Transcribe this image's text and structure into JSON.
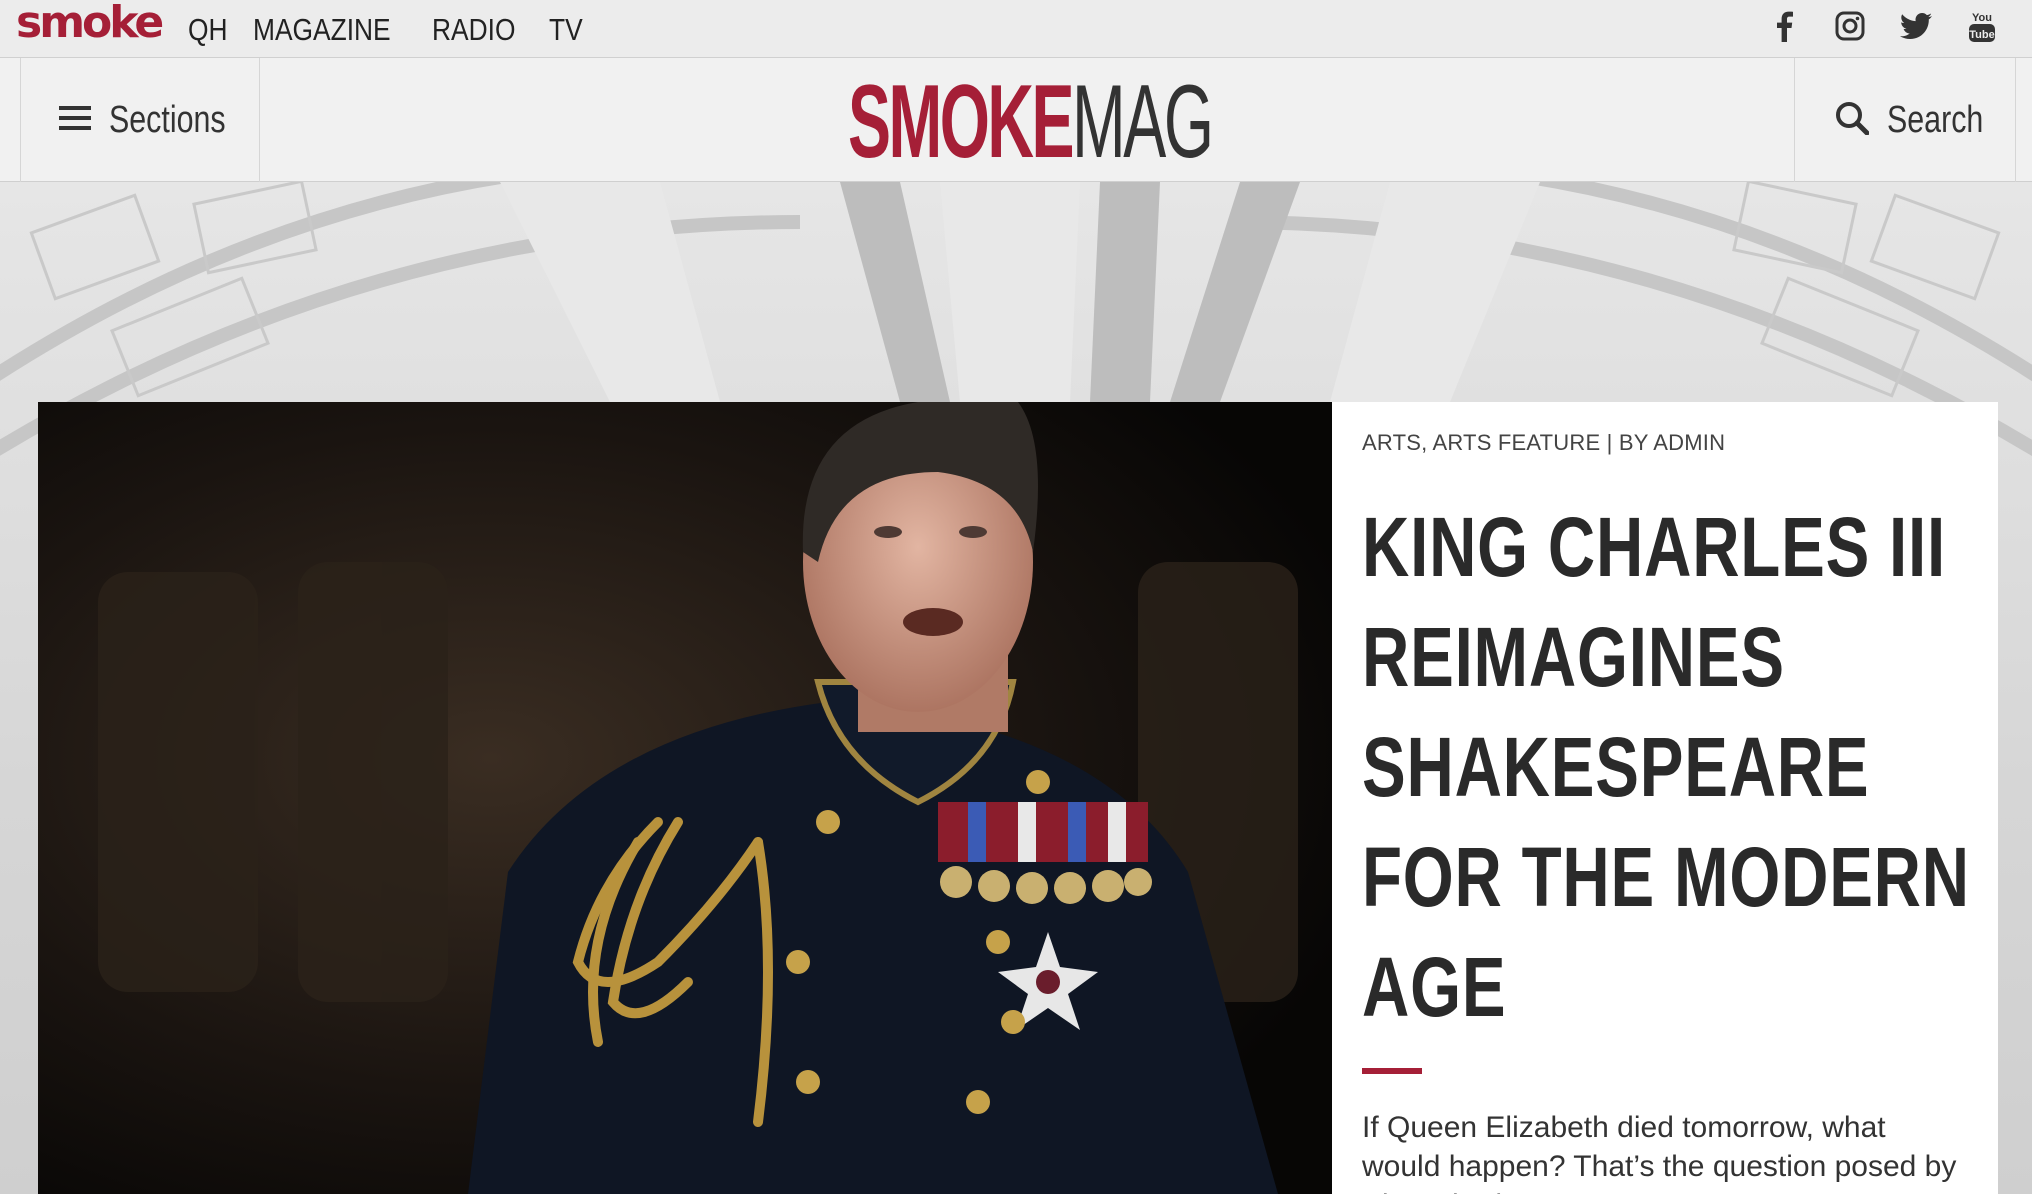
{
  "topbar": {
    "brand": "smoke",
    "nav": [
      "QH",
      "MAGAZINE",
      "RADIO",
      "TV"
    ],
    "social": [
      "facebook-icon",
      "instagram-icon",
      "twitter-icon",
      "youtube-icon"
    ]
  },
  "header": {
    "sections_label": "Sections",
    "logo_part1": "SMOKE",
    "logo_part2": "MAG",
    "search_label": "Search"
  },
  "feature": {
    "meta": "ARTS, ARTS FEATURE | BY ADMIN",
    "headline": "KING CHARLES III REIMAGINES SHAKESPEARE FOR THE MODERN AGE",
    "excerpt": "If Queen Elizabeth died tomorrow, what would happen? That’s the question posed by King Charles"
  },
  "colors": {
    "accent": "#a51f37",
    "text": "#2a2a2a"
  }
}
